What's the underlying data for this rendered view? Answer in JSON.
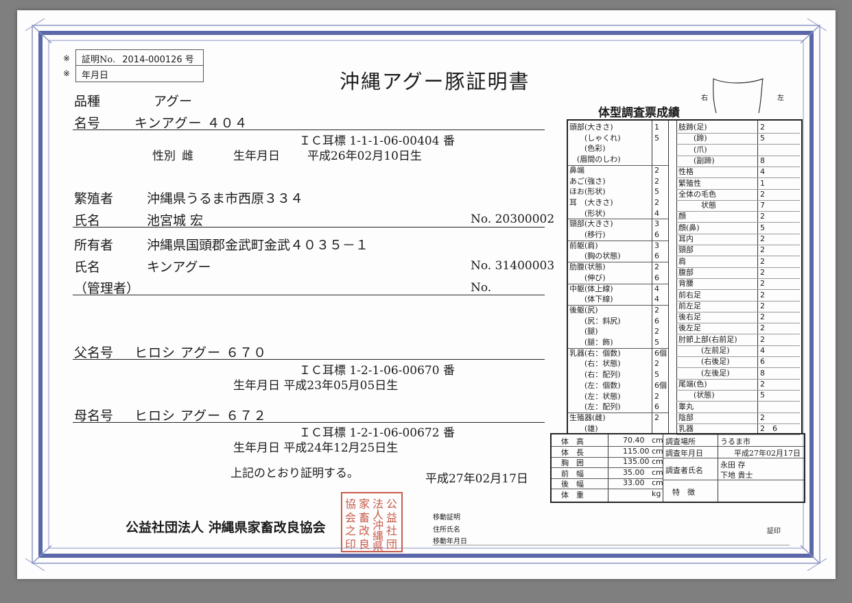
{
  "cert": {
    "mark": "※",
    "number_label": "証明No.",
    "number_value": "2014-000126 号",
    "date_label": "年月日"
  },
  "title": "沖縄アグー豚証明書",
  "breed": {
    "label": "品種",
    "value": "アグー"
  },
  "name": {
    "label": "名号",
    "value": "キンアグー ４０４"
  },
  "ic_tag": "ＩＣ耳標 1-1-1-06-00404 番",
  "sex": {
    "label": "性別",
    "value": "雌"
  },
  "birth": {
    "label": "生年月日",
    "value": "平成26年02月10日生"
  },
  "breeder": {
    "label": "繁殖者",
    "address": "沖縄県うるま市西原３３４",
    "name_label": "氏名",
    "name": "池宮城 宏",
    "no": "No. 20300002"
  },
  "owner": {
    "label": "所有者",
    "address": "沖縄県国頭郡金武町金武４０３５－１",
    "name_label": "氏名",
    "name": "キンアグー",
    "no": "No. 31400003",
    "manager_label": "（管理者）",
    "manager_no": "No."
  },
  "father": {
    "label": "父名号",
    "value": "ヒロシ アグー ６７０",
    "ic": "ＩＣ耳標 1-2-1-06-00670 番",
    "birth": "生年月日 平成23年05月05日生"
  },
  "mother": {
    "label": "母名号",
    "value": "ヒロシ アグー ６７２",
    "ic": "ＩＣ耳標 1-2-1-06-00672 番",
    "birth": "生年月日 平成24年12月25日生"
  },
  "certify_text": "上記のとおり証明する。",
  "issue_date": "平成27年02月17日",
  "org": "公益社団法人 沖縄県家畜改良協会",
  "seal_chars": [
    "公",
    "益",
    "社",
    "団",
    "法",
    "人",
    "沖",
    "縄",
    "県",
    "家",
    "畜",
    "改",
    "良",
    "協",
    "会",
    "之",
    "印"
  ],
  "transfer": {
    "line1": "移動証明",
    "line2": "住所氏名",
    "line3": "移動年月日",
    "stamp": "証印"
  },
  "ear": {
    "right": "右",
    "left": "左"
  },
  "survey": {
    "title": "体型調査票成績",
    "left": [
      [
        "頭部(大きさ)",
        "1"
      ],
      [
        "　　(しゃくれ)",
        "5"
      ],
      [
        "　　(色彩)",
        ""
      ],
      [
        "　(眉間のしわ)",
        ""
      ],
      [
        "鼻端",
        "2"
      ],
      [
        "あご(強さ)",
        "2"
      ],
      [
        "ほお(形状)",
        "5"
      ],
      [
        "耳　(大きさ)",
        "2"
      ],
      [
        "　　(形状)",
        "4"
      ],
      [
        "頸部(大きさ)",
        "3"
      ],
      [
        "　　(移行)",
        "6"
      ],
      [
        "前躯(肩)",
        "3"
      ],
      [
        "　　(胸の状態)",
        "6"
      ],
      [
        "肋腹(状態)",
        "2"
      ],
      [
        "　　(伸び)",
        "6"
      ],
      [
        "中躯(体上線)",
        "4"
      ],
      [
        "　　(体下線)",
        "4"
      ],
      [
        "後躯(尻)",
        "2"
      ],
      [
        "　　(尻：斜尻)",
        "6"
      ],
      [
        "　　(腿)",
        "2"
      ],
      [
        "　　(腿：飾)",
        "5"
      ],
      [
        "乳器(右：個数)",
        "6個"
      ],
      [
        "　　(右：状態)",
        "2"
      ],
      [
        "　　(右：配列)",
        "5"
      ],
      [
        "　　(左：個数)",
        "6個"
      ],
      [
        "　　(左：状態)",
        "2"
      ],
      [
        "　　(左：配列)",
        "6"
      ],
      [
        "生殖器(雌)",
        "2"
      ],
      [
        "　　(雄)",
        ""
      ]
    ],
    "right": [
      [
        "肢蹄(足)",
        "2"
      ],
      [
        "　　(蹄)",
        "5"
      ],
      [
        "　　(爪)",
        ""
      ],
      [
        "　　(副蹄)",
        "8"
      ],
      [
        "性格",
        "4"
      ],
      [
        "繁殖性",
        "1"
      ],
      [
        "全体の毛色",
        "2"
      ],
      [
        "　　　状態",
        "7"
      ],
      [
        "顔",
        "2"
      ],
      [
        "顔(鼻)",
        "5"
      ],
      [
        "耳内",
        "2"
      ],
      [
        "頸部",
        "2"
      ],
      [
        "肩",
        "2"
      ],
      [
        "腹部",
        "2"
      ],
      [
        "背腰",
        "2"
      ],
      [
        "前右足",
        "2"
      ],
      [
        "前左足",
        "2"
      ],
      [
        "後右足",
        "2"
      ],
      [
        "後左足",
        "2"
      ],
      [
        "肘節上部(右前足)",
        "2"
      ],
      [
        "　　　(左前足)",
        "4"
      ],
      [
        "　　　(右後足)",
        "6"
      ],
      [
        "　　　(左後足)",
        "8"
      ],
      [
        "尾端(色)",
        "2"
      ],
      [
        "　　(状態)",
        "5"
      ],
      [
        "睾丸",
        ""
      ],
      [
        "陰部",
        "2"
      ],
      [
        "乳器",
        "2　6"
      ]
    ]
  },
  "measurements": [
    {
      "label": "体　高",
      "value": "70.40",
      "unit": "cm"
    },
    {
      "label": "体　長",
      "value": "115.00",
      "unit": "cm"
    },
    {
      "label": "胸　囲",
      "value": "135.00",
      "unit": "cm"
    },
    {
      "label": "前　幅",
      "value": "35.00",
      "unit": "cm"
    },
    {
      "label": "後　幅",
      "value": "33.00",
      "unit": "cm"
    },
    {
      "label": "体　重",
      "value": "",
      "unit": "kg"
    }
  ],
  "survey_info": {
    "place_label": "調査場所",
    "place": "うるま市",
    "date_label": "調査年月日",
    "date": "平成27年02月17日",
    "surveyor_label": "調査者氏名",
    "surveyor1": "永田 存",
    "surveyor2": "下地 貴士",
    "feature_label": "特　徴"
  },
  "colors": {
    "frame": "#5a67a8",
    "seal": "#c95a4a"
  }
}
